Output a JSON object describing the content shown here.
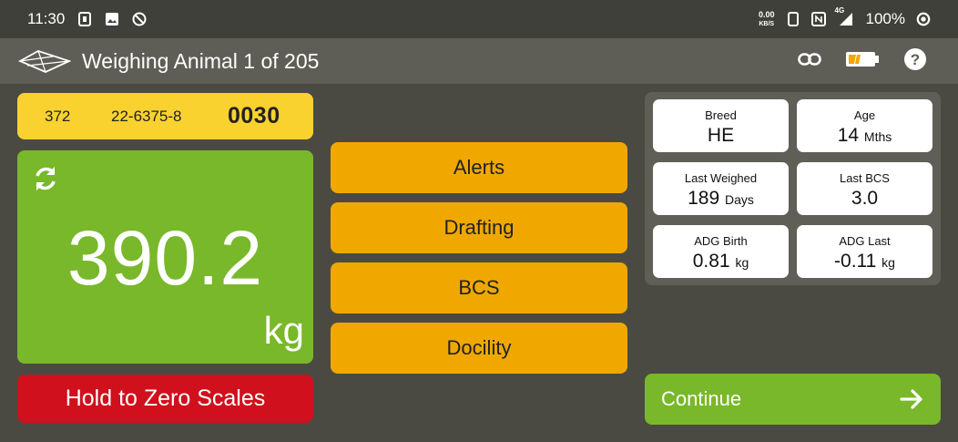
{
  "status_bar": {
    "time": "11:30",
    "net_speed_value": "0.00",
    "net_speed_unit": "KB/S",
    "signal_label": "4G",
    "battery": "100%"
  },
  "app_bar": {
    "title": "Weighing Animal 1 of 205",
    "icons": [
      "menu-logo",
      "link-icon",
      "battery-icon",
      "help-icon"
    ]
  },
  "tag": {
    "a": "372",
    "b": "22-6375-8",
    "c": "0030"
  },
  "weight": {
    "value": "390.2",
    "unit": "kg"
  },
  "zero_button": "Hold to Zero Scales",
  "actions": {
    "alerts": "Alerts",
    "drafting": "Drafting",
    "bcs": "BCS",
    "docility": "Docility"
  },
  "info": {
    "breed": {
      "label": "Breed",
      "value": "HE",
      "unit": ""
    },
    "age": {
      "label": "Age",
      "value": "14",
      "unit": "Mths"
    },
    "last_weighed": {
      "label": "Last Weighed",
      "value": "189",
      "unit": "Days"
    },
    "last_bcs": {
      "label": "Last BCS",
      "value": "3.0",
      "unit": ""
    },
    "adg_birth": {
      "label": "ADG Birth",
      "value": "0.81",
      "unit": "kg"
    },
    "adg_last": {
      "label": "ADG Last",
      "value": "-0.11",
      "unit": "kg"
    }
  },
  "continue_button": "Continue",
  "colors": {
    "yellow": "#f9d230",
    "green": "#78b82a",
    "red": "#d0101c",
    "orange": "#f0a800",
    "background": "#4a4a42"
  }
}
